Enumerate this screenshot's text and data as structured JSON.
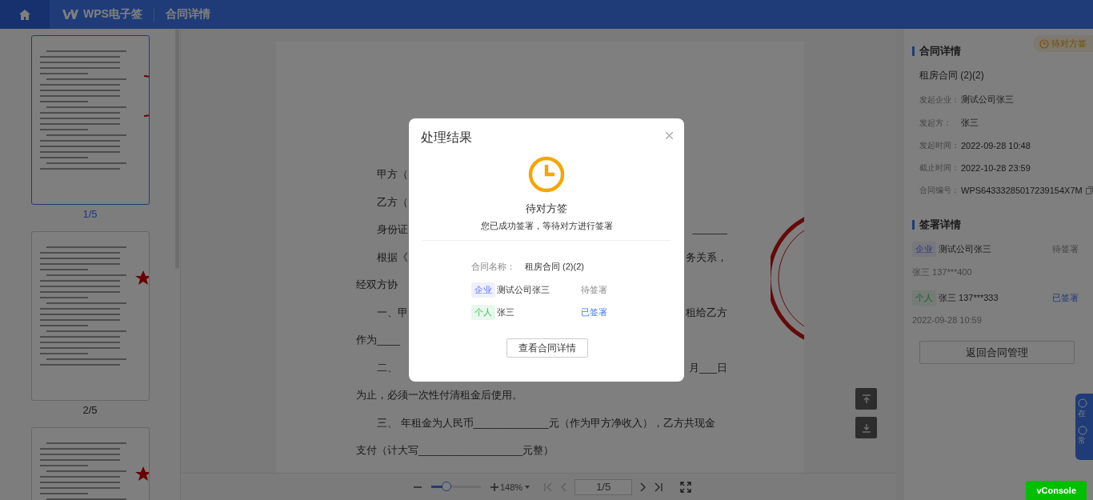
{
  "header": {
    "brand": "WPS电子签",
    "page_title": "合同详情"
  },
  "thumbnails": [
    {
      "label": "1/5",
      "selected": true,
      "kind": "arc"
    },
    {
      "label": "2/5",
      "selected": false,
      "kind": "star"
    },
    {
      "selected": false,
      "kind": "star"
    }
  ],
  "document": {
    "lines": [
      {
        "left": "甲方（",
        "indent": true
      },
      {
        "left": "乙方（",
        "indent": true
      },
      {
        "left": "身份证",
        "right": "______",
        "indent": true
      },
      {
        "left": "根据《",
        "right": "务关系，",
        "indent": true
      },
      {
        "left": "经双方协",
        "indent": false
      },
      {
        "left": "一、甲",
        "right": "租给乙方",
        "indent": true
      },
      {
        "left": "作为____",
        "indent": false
      },
      {
        "left": "二、",
        "right": "月___日",
        "indent": true
      },
      {
        "left": "为止，必须一次性付清租金后使用。",
        "indent": false
      },
      {
        "left": "三、 年租金为人民币_____________元（作为甲方净收入），乙方共现金",
        "indent": true
      },
      {
        "left": "支付（计大写__________________元整）",
        "indent": false
      }
    ]
  },
  "toolbar": {
    "zoom": {
      "level": 0.3
    },
    "zoom_text": "148%",
    "page": "1/5",
    "nav": [
      {
        "kind": "first",
        "disabled": true
      },
      {
        "kind": "prev",
        "disabled": true
      },
      {
        "kind": "next",
        "disabled": false
      },
      {
        "kind": "last",
        "disabled": false
      }
    ]
  },
  "side_panel": {
    "status_badge": "待对方签",
    "details_title": "合同详情",
    "contract_name": "租房合同 (2)(2)",
    "fields": [
      {
        "label": "发起企业：",
        "value": "测试公司张三"
      },
      {
        "label": "发起方：",
        "value": "张三"
      },
      {
        "label": "发起时间：",
        "value": "2022-09-28 10:48"
      },
      {
        "label": "截止时间：",
        "value": "2022-10-28 23:59"
      },
      {
        "label": "合同编号：",
        "value": "WPS64333285017239154X7M",
        "copy": true
      }
    ],
    "signing_title": "签署详情",
    "signers": [
      {
        "kind": "company",
        "tag": "企业",
        "name": "测试公司张三",
        "status": "待签署",
        "signed": false,
        "sub": "张三 137***400"
      },
      {
        "kind": "personal",
        "tag": "个人",
        "name": "张三 137***333",
        "status": "已签署",
        "signed": true,
        "sub": "2022-09-28 10:59"
      }
    ],
    "back_button": "返回合同管理"
  },
  "floating_help": [
    "在",
    "常"
  ],
  "dialog": {
    "title": "处理结果",
    "status": "待对方签",
    "message": "您已成功签署，等待对方进行签署",
    "name_label": "合同名称：",
    "name_value": "租房合同 (2)(2)",
    "signers": [
      {
        "kind": "company",
        "tag": "企业",
        "name": "测试公司张三",
        "status": "待签署",
        "signed": false
      },
      {
        "kind": "personal",
        "tag": "个人",
        "name": "张三",
        "status": "已签署",
        "signed": true
      }
    ],
    "button": "查看合同详情"
  },
  "vconsole": "vConsole"
}
